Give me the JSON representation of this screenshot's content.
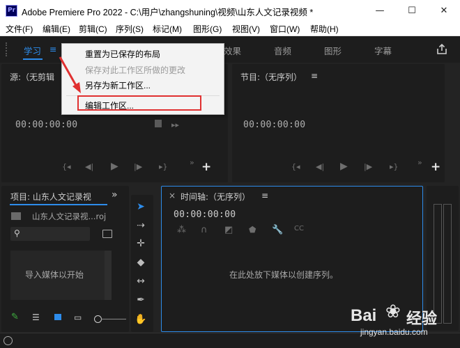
{
  "window": {
    "title": "Adobe Premiere Pro 2022 - C:\\用户\\zhangshuning\\视频\\山东人文记录视频 *",
    "app_icon_text": "Pr",
    "minimize": "—",
    "maximize": "☐",
    "close": "✕"
  },
  "menubar": [
    "文件(F)",
    "编辑(E)",
    "剪辑(C)",
    "序列(S)",
    "标记(M)",
    "图形(G)",
    "视图(V)",
    "窗口(W)",
    "帮助(H)"
  ],
  "workspace_bar": {
    "active_tab": "学习",
    "menu_glyph": "≡",
    "tabs": [
      "效果",
      "音频",
      "图形",
      "字幕"
    ]
  },
  "dropdown": {
    "items": [
      "重置为已保存的布局",
      "保存对此工作区所做的更改",
      "另存为新工作区...",
      "编辑工作区..."
    ]
  },
  "source_panel": {
    "title": "源:（无剪辑",
    "timecode": "00:00:00:00"
  },
  "program_panel": {
    "title": "节目:（无序列）",
    "menu_glyph": "≡",
    "timecode": "00:00:00:00"
  },
  "project_panel": {
    "title": "项目: 山东人文记录视",
    "overflow": "»",
    "file_name": "山东人文记录视...roj",
    "import_text": "导入媒体以开始"
  },
  "timeline_panel": {
    "close": "×",
    "title": "时间轴:（无序列）",
    "menu_glyph": "≡",
    "timecode": "00:00:00:00",
    "empty_text": "在此处放下媒体以创建序列。"
  },
  "watermark": {
    "brand": "Bai",
    "brand2": "经验",
    "url": "jingyan.baidu.com"
  },
  "colors": {
    "accent_blue": "#2d8ceb",
    "highlight_red": "#e03030",
    "panel_bg": "#1d1d1d",
    "app_bg": "#232323"
  }
}
